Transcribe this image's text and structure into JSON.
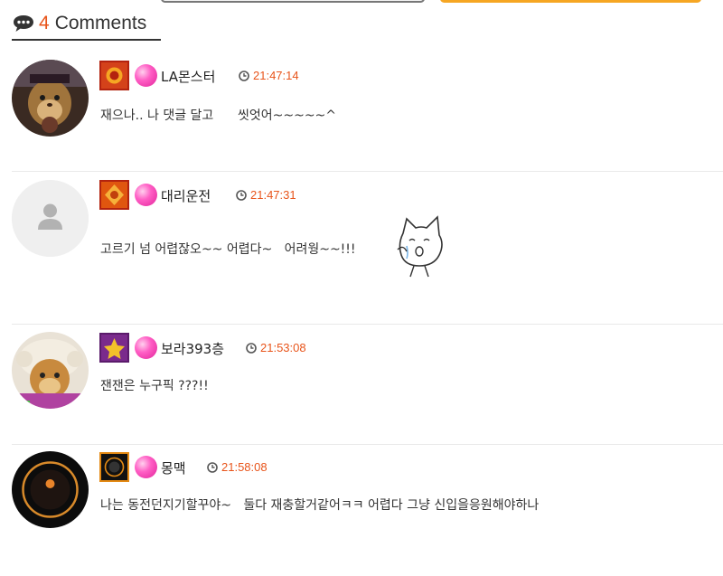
{
  "header": {
    "count": "4",
    "label": "Comments"
  },
  "colors": {
    "accent": "#e8541a",
    "candy": "#ff5fc5",
    "divider": "#e9e9e9"
  },
  "comments": [
    {
      "nickname": "LA몬스터",
      "time": "21:47:14",
      "text": "재으나.. 나 댓글 달고      씻엇어~~~~~^",
      "avatar_icon": "hamster-avatar-icon",
      "badge_icon": "level-badge-red-icon"
    },
    {
      "nickname": "대리운전",
      "time": "21:47:31",
      "text": "고르기 넘 어렵잖오~~ 어렵다~   어려웡~~!!!",
      "avatar_icon": "default-user-avatar-icon",
      "badge_icon": "level-badge-orange-icon",
      "emoticon": "crying-cat-emoticon-icon"
    },
    {
      "nickname": "보라393층",
      "time": "21:53:08",
      "text": "잰잰은 누구픽 ???!!",
      "avatar_icon": "judge-cat-avatar-icon",
      "badge_icon": "level-badge-purple-icon"
    },
    {
      "nickname": "몽맥",
      "time": "21:58:08",
      "text": "나는 동전던지기할꾸야~   둘다 재충할거같어ㅋㅋ 어렵다 그냥 신입을응원해야하나",
      "avatar_icon": "play-logo-avatar-icon",
      "badge_icon": "play-badge-icon"
    }
  ]
}
